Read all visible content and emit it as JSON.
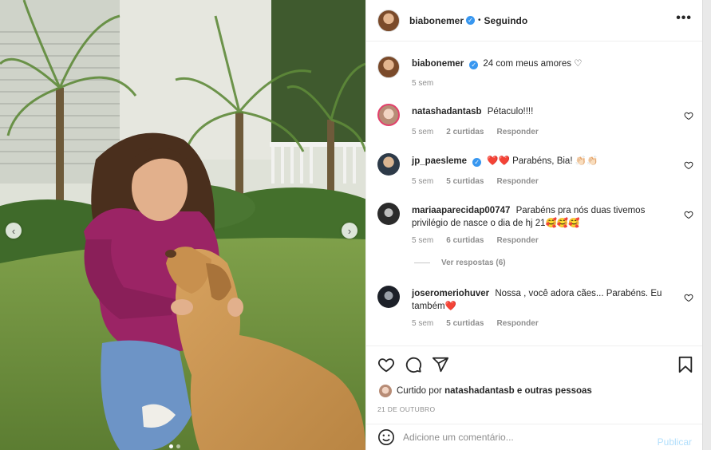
{
  "post": {
    "owner": "biabonemer",
    "separator": "•",
    "follow_status": "Seguindo",
    "caption": "24 com meus amores ♡",
    "caption_time": "5 sem"
  },
  "comments": [
    {
      "user": "natashadantasb",
      "text": "Pétaculo!!!!",
      "time": "5 sem",
      "likes": "2 curtidas",
      "reply": "Responder",
      "verified": false
    },
    {
      "user": "jp_paesleme",
      "text": "❤️❤️ Parabéns, Bia! 👏🏻👏🏻",
      "time": "5 sem",
      "likes": "5 curtidas",
      "reply": "Responder",
      "verified": true
    },
    {
      "user": "mariaaparecidap00747",
      "text": "Parabéns pra nós duas tivemos privilégio de nasce o dia de hj 21🥰🥰🥰",
      "time": "5 sem",
      "likes": "6 curtidas",
      "reply": "Responder",
      "verified": false
    },
    {
      "user": "joseromeriohuver",
      "text": "Nossa , você adora cães... Parabéns. Eu também❤️",
      "time": "5 sem",
      "likes": "5 curtidas",
      "reply": "Responder",
      "verified": false
    }
  ],
  "view_replies": "Ver respostas (6)",
  "liked_by": {
    "prefix": "Curtido por",
    "user": "natashadantasb",
    "suffix": "e outras pessoas"
  },
  "date": "21 DE OUTUBRO",
  "composer": {
    "placeholder": "Adicione um comentário...",
    "publish": "Publicar"
  },
  "icons": [
    "heart-icon",
    "comment-icon",
    "share-icon",
    "bookmark-icon",
    "emoji-icon",
    "more-icon",
    "chevron-left-icon",
    "chevron-right-icon"
  ],
  "colors": {
    "verified": "#3897f0",
    "publish_disabled": "#b2dffc",
    "heart_red": "#ed4956"
  }
}
